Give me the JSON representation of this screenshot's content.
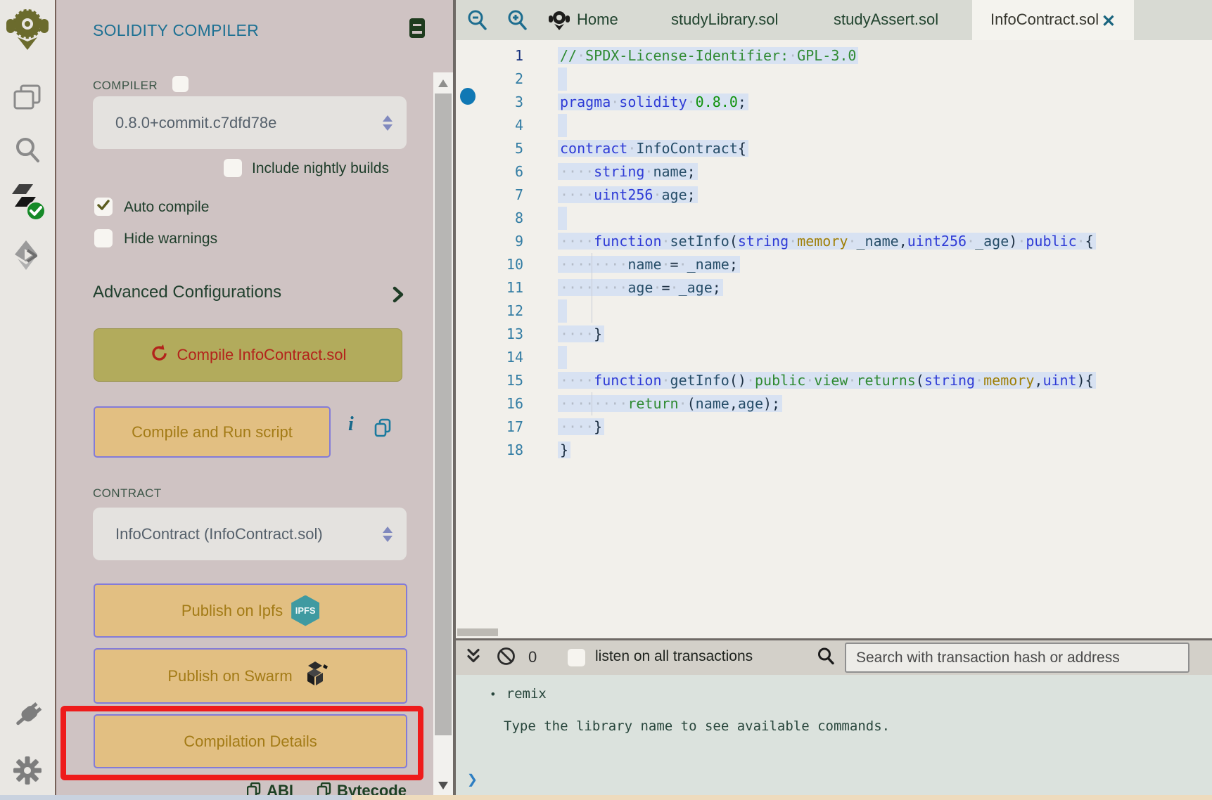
{
  "colors": {
    "accent_title": "#1e7193",
    "olive_button": "#b2ab5c",
    "tan_button": "#e2bf82",
    "red_annotation": "#ee1b1b",
    "selection_highlight": "#d8e2f2",
    "breakpoint_blue": "#1078b4",
    "ipfs_badge": "#3f9aa1"
  },
  "rail": {
    "icons": [
      "remix-logo",
      "file-explorer",
      "search",
      "solidity-compiler-active",
      "deploy-and-run",
      "plugin-manager",
      "settings"
    ]
  },
  "sidebar": {
    "title": "SOLIDITY COMPILER",
    "compiler_label": "COMPILER",
    "compiler_version": "0.8.0+commit.c7dfd78e",
    "include_nightly_label": "Include nightly builds",
    "auto_compile_label": "Auto compile",
    "auto_compile_checked": true,
    "hide_warnings_label": "Hide warnings",
    "advanced_label": "Advanced Configurations",
    "compile_button_label": "Compile InfoContract.sol",
    "compile_run_label": "Compile and Run script",
    "info_icon": "i",
    "contract_label": "CONTRACT",
    "contract_value": "InfoContract (InfoContract.sol)",
    "publish_ipfs_label": "Publish on Ipfs",
    "ipfs_badge_label": "IPFS",
    "publish_swarm_label": "Publish on Swarm",
    "compilation_details_label": "Compilation Details",
    "abi_label": "ABI",
    "bytecode_label": "Bytecode"
  },
  "tabs": {
    "items": [
      {
        "label": "Home"
      },
      {
        "label": "studyLibrary.sol"
      },
      {
        "label": "studyAssert.sol"
      },
      {
        "label": "InfoContract.sol",
        "active": true
      }
    ],
    "close_glyph": "✕"
  },
  "editor": {
    "lines": [
      {
        "n": 1,
        "active": true,
        "tokens": [
          [
            "cm",
            "//"
          ],
          [
            "ws",
            "·"
          ],
          [
            "cm",
            "SPDX-License-Identifier:"
          ],
          [
            "ws",
            "·"
          ],
          [
            "cm",
            "GPL-3.0"
          ]
        ]
      },
      {
        "n": 2,
        "tokens": []
      },
      {
        "n": 3,
        "tokens": [
          [
            "kw",
            "pragma"
          ],
          [
            "ws",
            "·"
          ],
          [
            "kw",
            "solidity"
          ],
          [
            "ws",
            "·"
          ],
          [
            "num",
            "0.8.0"
          ],
          [
            "pl",
            ";"
          ]
        ]
      },
      {
        "n": 4,
        "tokens": []
      },
      {
        "n": 5,
        "tokens": [
          [
            "kw",
            "contract"
          ],
          [
            "ws",
            "·"
          ],
          [
            "id",
            "InfoContract"
          ],
          [
            "pl",
            "{"
          ]
        ]
      },
      {
        "n": 6,
        "tokens": [
          [
            "ws",
            "····"
          ],
          [
            "kw",
            "string"
          ],
          [
            "ws",
            "·"
          ],
          [
            "id",
            "name"
          ],
          [
            "pl",
            ";"
          ]
        ]
      },
      {
        "n": 7,
        "tokens": [
          [
            "ws",
            "····"
          ],
          [
            "kw",
            "uint256"
          ],
          [
            "ws",
            "·"
          ],
          [
            "id",
            "age"
          ],
          [
            "pl",
            ";"
          ]
        ]
      },
      {
        "n": 8,
        "tokens": []
      },
      {
        "n": 9,
        "tokens": [
          [
            "ws",
            "····"
          ],
          [
            "kw",
            "function"
          ],
          [
            "ws",
            "·"
          ],
          [
            "id",
            "setInfo"
          ],
          [
            "pl",
            "("
          ],
          [
            "kw",
            "string"
          ],
          [
            "ws",
            "·"
          ],
          [
            "gold",
            "memory"
          ],
          [
            "ws",
            "·"
          ],
          [
            "id",
            "_name"
          ],
          [
            "pl",
            ","
          ],
          [
            "kw",
            "uint256"
          ],
          [
            "ws",
            "·"
          ],
          [
            "id",
            "_age"
          ],
          [
            "pl",
            ")"
          ],
          [
            "ws",
            "·"
          ],
          [
            "kw",
            "public"
          ],
          [
            "ws",
            "·"
          ],
          [
            "pl",
            "{"
          ]
        ]
      },
      {
        "n": 10,
        "guide": true,
        "tokens": [
          [
            "ws",
            "········"
          ],
          [
            "id",
            "name"
          ],
          [
            "ws",
            "·"
          ],
          [
            "pl",
            "="
          ],
          [
            "ws",
            "·"
          ],
          [
            "id",
            "_name"
          ],
          [
            "pl",
            ";"
          ]
        ]
      },
      {
        "n": 11,
        "guide": true,
        "tokens": [
          [
            "ws",
            "········"
          ],
          [
            "id",
            "age"
          ],
          [
            "ws",
            "·"
          ],
          [
            "pl",
            "="
          ],
          [
            "ws",
            "·"
          ],
          [
            "id",
            "_age"
          ],
          [
            "pl",
            ";"
          ]
        ]
      },
      {
        "n": 12,
        "guide": true,
        "tokens": []
      },
      {
        "n": 13,
        "tokens": [
          [
            "ws",
            "····"
          ],
          [
            "pl",
            "}"
          ]
        ]
      },
      {
        "n": 14,
        "tokens": []
      },
      {
        "n": 15,
        "tokens": [
          [
            "ws",
            "····"
          ],
          [
            "kw",
            "function"
          ],
          [
            "ws",
            "·"
          ],
          [
            "id",
            "getInfo"
          ],
          [
            "pl",
            "()"
          ],
          [
            "ws",
            "·"
          ],
          [
            "kw2",
            "public"
          ],
          [
            "ws",
            "·"
          ],
          [
            "kw2",
            "view"
          ],
          [
            "ws",
            "·"
          ],
          [
            "kw2",
            "returns"
          ],
          [
            "pl",
            "("
          ],
          [
            "kw",
            "string"
          ],
          [
            "ws",
            "·"
          ],
          [
            "gold",
            "memory"
          ],
          [
            "pl",
            ","
          ],
          [
            "kw",
            "uint"
          ],
          [
            "pl",
            "){"
          ]
        ]
      },
      {
        "n": 16,
        "guide": true,
        "tokens": [
          [
            "ws",
            "········"
          ],
          [
            "kw2",
            "return"
          ],
          [
            "ws",
            "·"
          ],
          [
            "pl",
            "("
          ],
          [
            "id",
            "name"
          ],
          [
            "pl",
            ","
          ],
          [
            "id",
            "age"
          ],
          [
            "pl",
            ");"
          ]
        ]
      },
      {
        "n": 17,
        "tokens": [
          [
            "ws",
            "····"
          ],
          [
            "pl",
            "}"
          ]
        ]
      },
      {
        "n": 18,
        "tokens": [
          [
            "pl",
            "}"
          ]
        ]
      }
    ]
  },
  "terminal": {
    "badge_count": "0",
    "listen_label": "listen on all transactions",
    "search_placeholder": "Search with transaction hash or address",
    "bullet": "•",
    "line1": "remix",
    "line2": "Type the library name to see available commands.",
    "prompt": "❯"
  }
}
